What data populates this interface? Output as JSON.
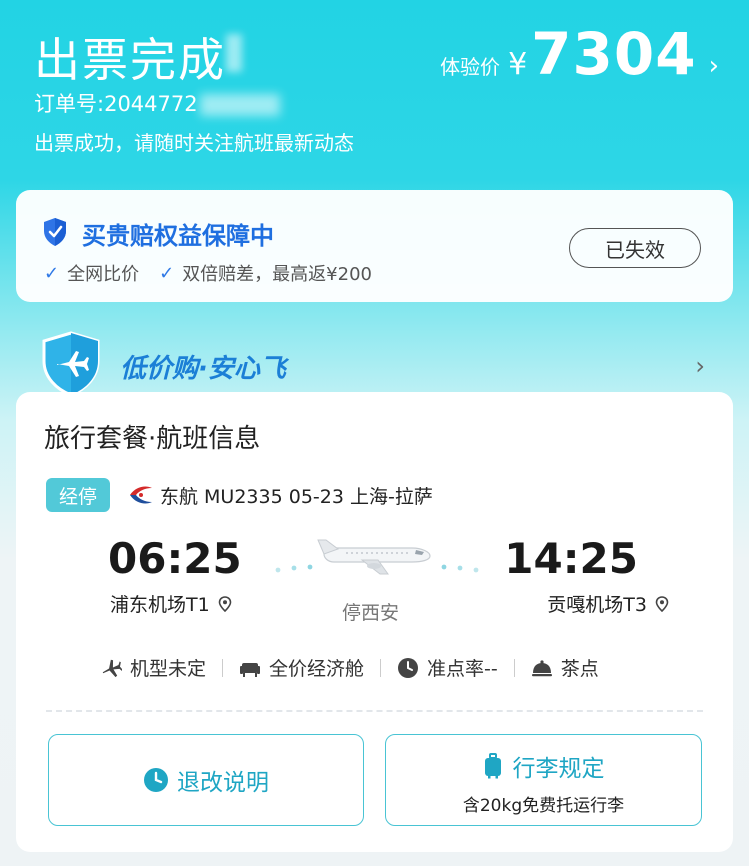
{
  "header": {
    "title": "出票完成",
    "order_label": "订单号:",
    "order_number": "2044772",
    "subtitle": "出票成功，请随时关注航班最新动态",
    "price_label": "体验价",
    "currency": "¥",
    "price": "7304",
    "chevron": "›"
  },
  "guarantee": {
    "title": "买贵赔权益保障中",
    "features": [
      "全网比价",
      "双倍赔差，最高返¥200"
    ],
    "status": "已失效"
  },
  "banner": {
    "title": "低价购·安心飞",
    "chevron": "›"
  },
  "flight": {
    "section_title": "旅行套餐·航班信息",
    "stop_badge": "经停",
    "meta": "东航 MU2335   05-23 上海-拉萨",
    "departure": {
      "time": "06:25",
      "airport": "浦东机场T1"
    },
    "arrival": {
      "time": "14:25",
      "airport": "贡嘎机场T3"
    },
    "stop_city": "停西安",
    "amenities": [
      {
        "icon": "plane-icon",
        "label": "机型未定"
      },
      {
        "icon": "seat-icon",
        "label": "全价经济舱"
      },
      {
        "icon": "clock-icon",
        "label": "准点率--"
      },
      {
        "icon": "meal-icon",
        "label": "茶点"
      }
    ]
  },
  "actions": {
    "refund_label": "退改说明",
    "baggage_label": "行李规定",
    "baggage_sub": "含20kg免费托运行李"
  },
  "colors": {
    "header_bg": "#22d3e4",
    "accent": "#1fa6c4",
    "guarantee_blue": "#1f6fe0",
    "badge": "#52c9d8"
  }
}
